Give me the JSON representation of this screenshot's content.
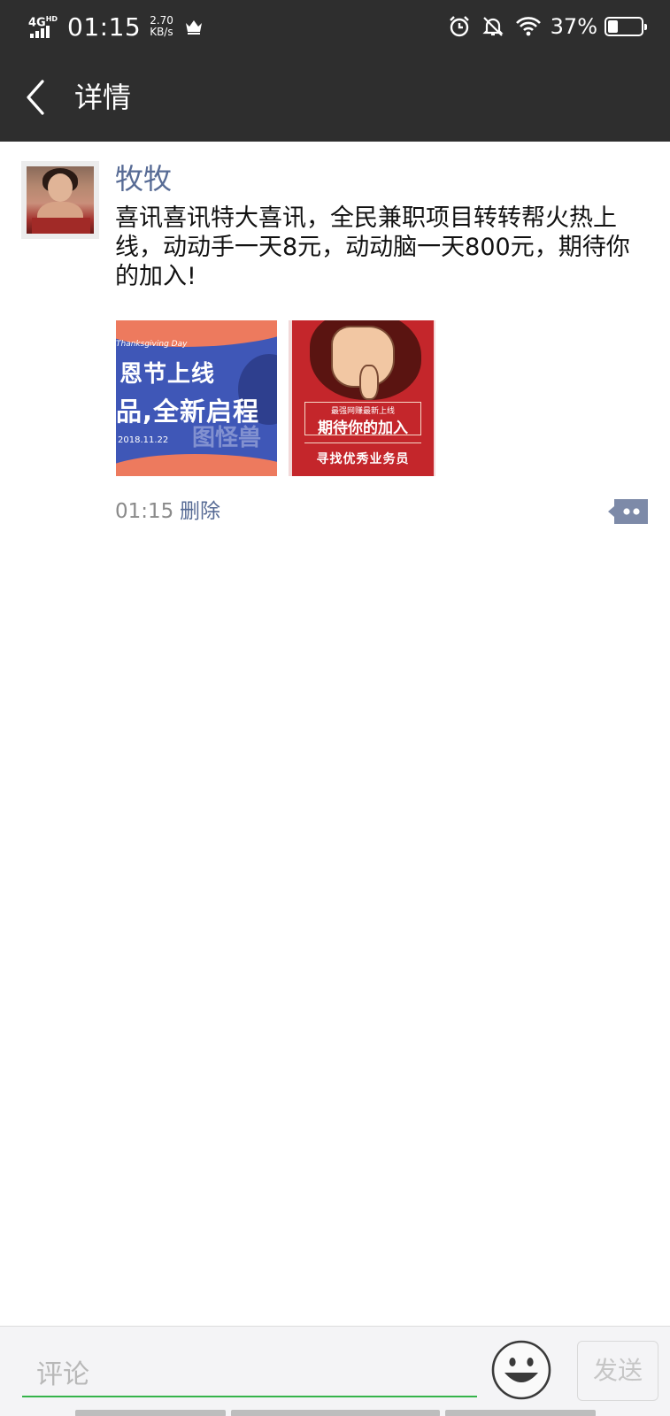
{
  "status_bar": {
    "network": "4G",
    "network_sup": "HD",
    "time": "01:15",
    "speed_value": "2.70",
    "speed_unit": "KB/s",
    "battery_percent": "37%",
    "battery_level": 0.37,
    "icons": [
      "crown-icon",
      "alarm-icon",
      "mute-bell-icon",
      "wifi-icon",
      "battery-icon"
    ]
  },
  "header": {
    "title": "详情",
    "back_icon": "chevron-left-icon"
  },
  "post": {
    "author": "牧牧",
    "text": "喜讯喜讯特大喜讯，全民兼职项目转转帮火热上线，动动手一天8元，动动脑一天800元，期待你的加入!",
    "images": [
      {
        "label_en": "Thanksgiving Day",
        "line1": "恩节上线",
        "line2": "品,全新启程",
        "date": "2018.11.22",
        "watermark": "图怪兽"
      },
      {
        "line_small": "最强网赚最新上线",
        "line_big": "期待你的加入",
        "line_bottom": "寻找优秀业务员"
      }
    ],
    "time": "01:15",
    "delete_label": "删除",
    "more_icon": "comment-more-icon"
  },
  "comment_bar": {
    "placeholder": "评论",
    "emoji_icon": "smiley-icon",
    "send_label": "发送"
  },
  "colors": {
    "header_bg": "#2e2e2e",
    "link_blue": "#576b95",
    "input_underline": "#35b44a"
  }
}
